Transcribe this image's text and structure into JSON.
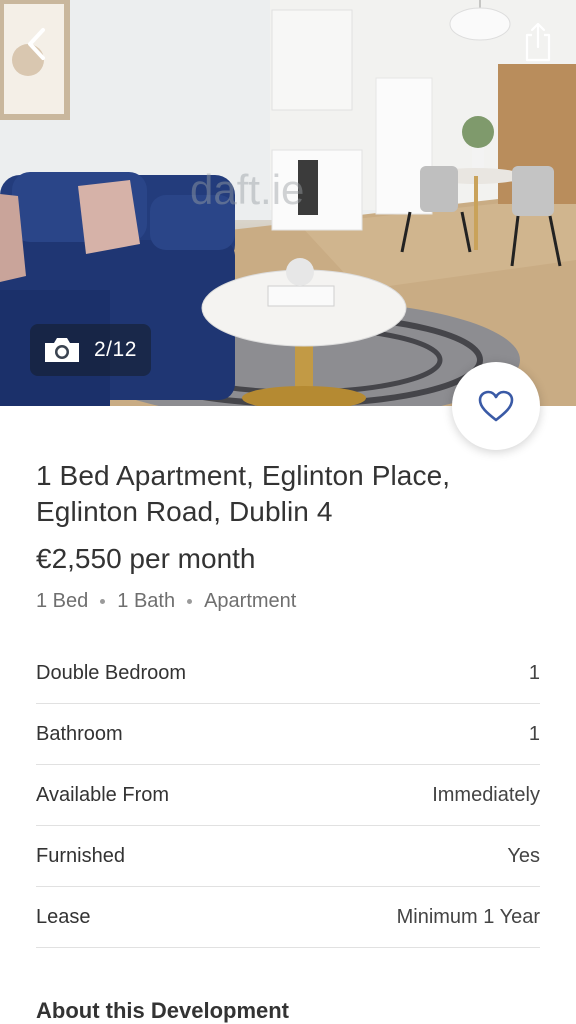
{
  "gallery": {
    "counter": "2/12",
    "watermark": "daft.ie"
  },
  "icons": {
    "back": "chevron-left-icon",
    "share": "share-icon",
    "camera": "camera-icon",
    "favourite": "heart-outline-icon"
  },
  "listing": {
    "title": "1 Bed Apartment, Eglinton Place, Eglinton Road, Dublin 4",
    "price": "€2,550 per month",
    "beds": "1 Bed",
    "baths": "1 Bath",
    "type": "Apartment"
  },
  "details": [
    {
      "label": "Double Bedroom",
      "value": "1"
    },
    {
      "label": "Bathroom",
      "value": "1"
    },
    {
      "label": "Available From",
      "value": "Immediately"
    },
    {
      "label": "Furnished",
      "value": "Yes"
    },
    {
      "label": "Lease",
      "value": "Minimum 1 Year"
    }
  ],
  "sections": {
    "about": "About this Development"
  },
  "colors": {
    "accent": "#3a5aa6",
    "sofa": "#233c7c"
  }
}
